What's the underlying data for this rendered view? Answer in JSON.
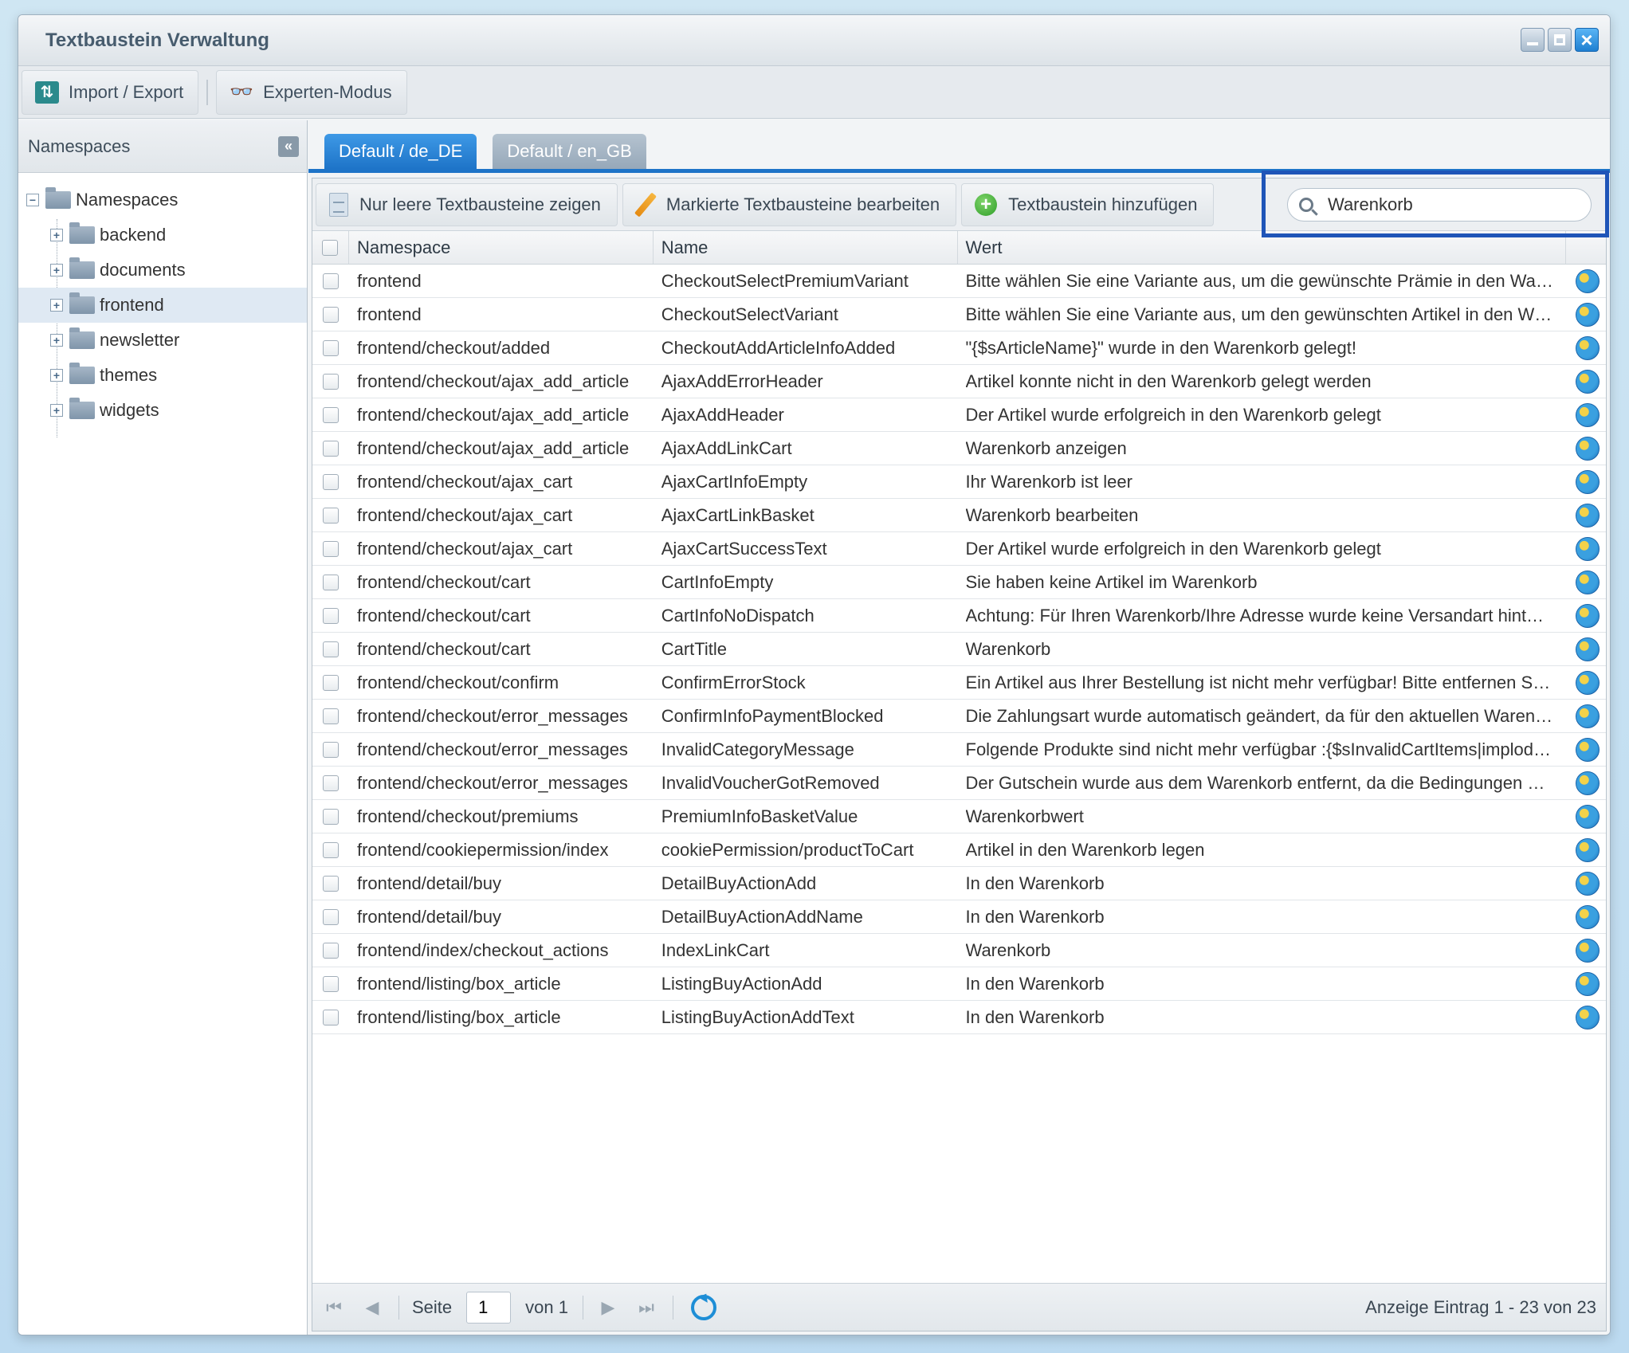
{
  "window": {
    "title": "Textbaustein Verwaltung"
  },
  "toolbar": {
    "import_export": "Import / Export",
    "expert_mode": "Experten-Modus"
  },
  "sidebar": {
    "header": "Namespaces",
    "collapse_glyph": "«",
    "root": "Namespaces",
    "items": [
      "backend",
      "documents",
      "frontend",
      "newsletter",
      "themes",
      "widgets"
    ],
    "selected": "frontend"
  },
  "tabs": [
    {
      "label": "Default / de_DE",
      "active": true
    },
    {
      "label": "Default / en_GB",
      "active": false
    }
  ],
  "grid_toolbar": {
    "empty_only": "Nur leere Textbausteine zeigen",
    "edit_marked": "Markierte Textbausteine bearbeiten",
    "add": "Textbaustein hinzufügen"
  },
  "search": {
    "value": "Warenkorb"
  },
  "columns": {
    "namespace": "Namespace",
    "name": "Name",
    "value": "Wert"
  },
  "rows": [
    {
      "namespace": "frontend",
      "name": "CheckoutSelectPremiumVariant",
      "value": "Bitte wählen Sie eine Variante aus, um die gewünschte Prämie in den Wa…"
    },
    {
      "namespace": "frontend",
      "name": "CheckoutSelectVariant",
      "value": "Bitte wählen Sie eine Variante aus, um den gewünschten Artikel in den W…"
    },
    {
      "namespace": "frontend/checkout/added",
      "name": "CheckoutAddArticleInfoAdded",
      "value": "\"{$sArticleName}\" wurde in den Warenkorb gelegt!"
    },
    {
      "namespace": "frontend/checkout/ajax_add_article",
      "name": "AjaxAddErrorHeader",
      "value": "Artikel konnte nicht in den Warenkorb gelegt werden"
    },
    {
      "namespace": "frontend/checkout/ajax_add_article",
      "name": "AjaxAddHeader",
      "value": "Der Artikel wurde erfolgreich in den Warenkorb gelegt"
    },
    {
      "namespace": "frontend/checkout/ajax_add_article",
      "name": "AjaxAddLinkCart",
      "value": "Warenkorb anzeigen"
    },
    {
      "namespace": "frontend/checkout/ajax_cart",
      "name": "AjaxCartInfoEmpty",
      "value": "Ihr Warenkorb ist leer"
    },
    {
      "namespace": "frontend/checkout/ajax_cart",
      "name": "AjaxCartLinkBasket",
      "value": "Warenkorb bearbeiten"
    },
    {
      "namespace": "frontend/checkout/ajax_cart",
      "name": "AjaxCartSuccessText",
      "value": "Der Artikel wurde erfolgreich in den Warenkorb gelegt"
    },
    {
      "namespace": "frontend/checkout/cart",
      "name": "CartInfoEmpty",
      "value": "Sie haben keine Artikel im Warenkorb"
    },
    {
      "namespace": "frontend/checkout/cart",
      "name": "CartInfoNoDispatch",
      "value": "Achtung: Für Ihren Warenkorb/Ihre Adresse wurde keine Versandart hint…"
    },
    {
      "namespace": "frontend/checkout/cart",
      "name": "CartTitle",
      "value": "Warenkorb"
    },
    {
      "namespace": "frontend/checkout/confirm",
      "name": "ConfirmErrorStock",
      "value": "Ein Artikel aus Ihrer Bestellung ist nicht mehr verfügbar! Bitte entfernen S…"
    },
    {
      "namespace": "frontend/checkout/error_messages",
      "name": "ConfirmInfoPaymentBlocked",
      "value": "Die Zahlungsart wurde automatisch geändert, da für den aktuellen Waren…"
    },
    {
      "namespace": "frontend/checkout/error_messages",
      "name": "InvalidCategoryMessage",
      "value": "Folgende Produkte sind nicht mehr verfügbar :{$sInvalidCartItems|implod…"
    },
    {
      "namespace": "frontend/checkout/error_messages",
      "name": "InvalidVoucherGotRemoved",
      "value": "Der Gutschein wurde aus dem Warenkorb entfernt, da die Bedingungen …"
    },
    {
      "namespace": "frontend/checkout/premiums",
      "name": "PremiumInfoBasketValue",
      "value": "Warenkorbwert"
    },
    {
      "namespace": "frontend/cookiepermission/index",
      "name": "cookiePermission/productToCart",
      "value": "Artikel in den Warenkorb legen"
    },
    {
      "namespace": "frontend/detail/buy",
      "name": "DetailBuyActionAdd",
      "value": "In den Warenkorb"
    },
    {
      "namespace": "frontend/detail/buy",
      "name": "DetailBuyActionAddName",
      "value": "In den Warenkorb"
    },
    {
      "namespace": "frontend/index/checkout_actions",
      "name": "IndexLinkCart",
      "value": "Warenkorb"
    },
    {
      "namespace": "frontend/listing/box_article",
      "name": "ListingBuyActionAdd",
      "value": "In den Warenkorb"
    },
    {
      "namespace": "frontend/listing/box_article",
      "name": "ListingBuyActionAddText",
      "value": "In den Warenkorb"
    }
  ],
  "pager": {
    "page_label": "Seite",
    "page_value": "1",
    "of_label": "von 1",
    "info": "Anzeige Eintrag 1 - 23 von 23"
  },
  "colors": {
    "accent": "#1e74c8",
    "highlight": "#1f55b8"
  }
}
